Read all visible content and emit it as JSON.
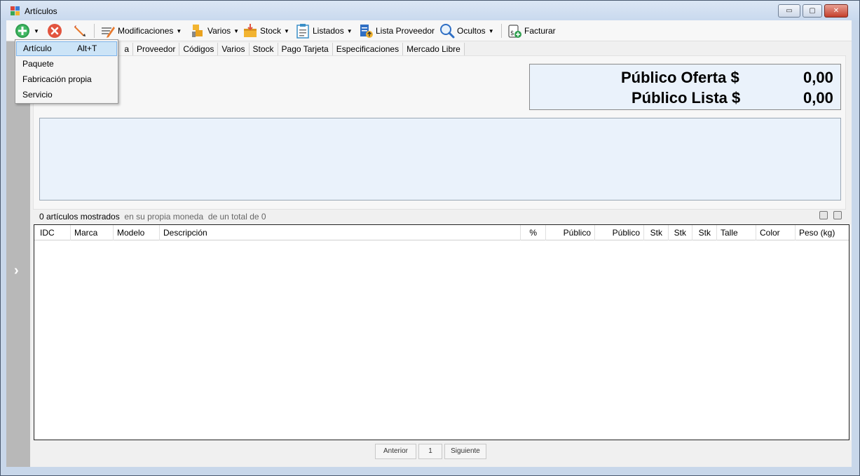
{
  "window": {
    "title": "Artículos",
    "min_label": "▭",
    "max_label": "▢",
    "close_label": "✕"
  },
  "toolbar": {
    "modificaciones": "Modificaciones",
    "varios": "Varios",
    "stock": "Stock",
    "listados": "Listados",
    "lista_proveedor": "Lista Proveedor",
    "ocultos": "Ocultos",
    "facturar": "Facturar"
  },
  "tabs": [
    "a",
    "Proveedor",
    "Códigos",
    "Varios",
    "Stock",
    "Pago Tarjeta",
    "Especificaciones",
    "Mercado Libre"
  ],
  "prices": {
    "oferta_label": "Público Oferta $",
    "oferta_value": "0,00",
    "lista_label": "Público Lista $",
    "lista_value": "0,00"
  },
  "status": {
    "count": "0 artículos mostrados",
    "moneda": "en su propia moneda",
    "total": "de un total de 0"
  },
  "grid": {
    "columns": [
      "IDC",
      "Marca",
      "Modelo",
      "Descripción",
      "%",
      "Público",
      "Público",
      "Stk",
      "Stk",
      "Stk",
      "Talle",
      "Color",
      "Peso (kg)"
    ]
  },
  "pager": {
    "prev": "Anterior",
    "page": "1",
    "next": "Siguiente"
  },
  "dropdown": {
    "items": [
      {
        "label": "Artículo",
        "shortcut": "Alt+T"
      },
      {
        "label": "Paquete"
      },
      {
        "label": "Fabricación propia"
      },
      {
        "label": "Servicio"
      }
    ]
  },
  "colors": {
    "accent_blue": "#cce4f7",
    "panel_blue": "#eaf2fb",
    "add_green": "#2e9e4e",
    "cancel_red": "#e2543e"
  }
}
